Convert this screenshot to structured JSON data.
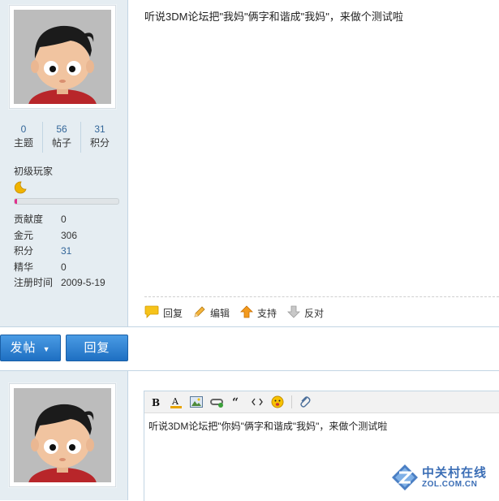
{
  "post1": {
    "profile": {
      "stats": [
        {
          "value": "0",
          "label": "主题"
        },
        {
          "value": "56",
          "label": "帖子"
        },
        {
          "value": "31",
          "label": "积分"
        }
      ],
      "rank": "初级玩家",
      "rank_icon": "moon-icon",
      "progress_fraction": 0.02,
      "info": [
        {
          "key": "贡献度",
          "value": "0"
        },
        {
          "key": "金元",
          "value": "306"
        },
        {
          "key": "积分",
          "value": "31"
        },
        {
          "key": "精华",
          "value": "0"
        },
        {
          "key": "注册时间",
          "value": "2009-5-19"
        }
      ]
    },
    "content": "听说3DM论坛把\"我妈\"俩字和谐成\"我妈\"，来做个测试啦",
    "actions": [
      {
        "label": "回复",
        "icon": "reply-bubble-icon"
      },
      {
        "label": "编辑",
        "icon": "pencil-icon"
      },
      {
        "label": "支持",
        "icon": "up-arrow-icon"
      },
      {
        "label": "反对",
        "icon": "down-arrow-icon"
      }
    ]
  },
  "buttons": {
    "post_label": "发帖",
    "reply_label": "回复"
  },
  "editor": {
    "toolbar": [
      "bold-icon",
      "font-color-icon",
      "image-icon",
      "link-icon",
      "quote-icon",
      "code-icon",
      "smiley-icon",
      "attachment-icon"
    ],
    "text": "听说3DM论坛把\"你妈\"俩字和谐成\"我妈\"，来做个测试啦"
  },
  "watermark": {
    "name": "中关村在线",
    "url": "ZOL.COM.CN"
  },
  "colors": {
    "sidebar_bg": "#e5edf2",
    "border": "#c2d5e3",
    "link": "#336699",
    "button": "#2a7ad2"
  }
}
